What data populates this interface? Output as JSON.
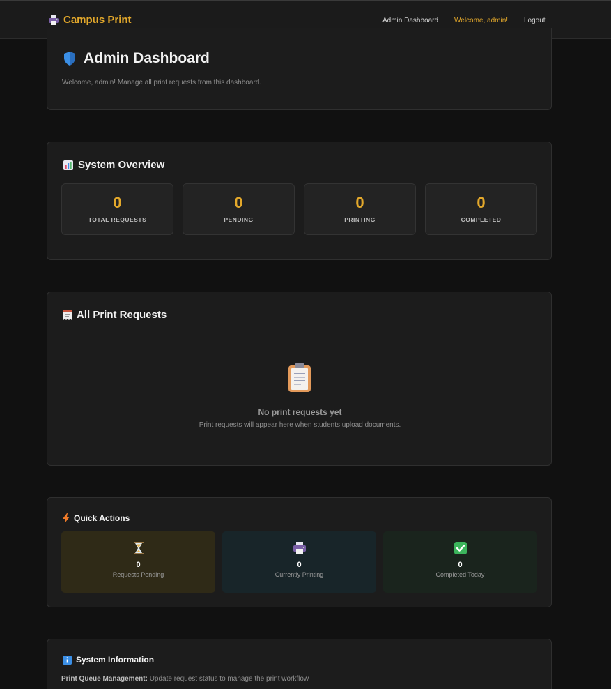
{
  "navbar": {
    "brand": "Campus Print",
    "brand_icon": "printer-icon",
    "links": {
      "dashboard": "Admin Dashboard",
      "welcome": "Welcome, admin!",
      "logout": "Logout"
    }
  },
  "header": {
    "icon": "shield-icon",
    "title": "Admin Dashboard",
    "subtitle": "Welcome, admin! Manage all print requests from this dashboard."
  },
  "overview": {
    "icon": "bar-chart-icon",
    "title": "System Overview",
    "stats": [
      {
        "value": "0",
        "label": "TOTAL REQUESTS"
      },
      {
        "value": "0",
        "label": "PENDING"
      },
      {
        "value": "0",
        "label": "PRINTING"
      },
      {
        "value": "0",
        "label": "COMPLETED"
      }
    ]
  },
  "requests": {
    "icon": "receipt-icon",
    "title": "All Print Requests",
    "empty_icon": "clipboard-icon",
    "empty_title": "No print requests yet",
    "empty_text": "Print requests will appear here when students upload documents."
  },
  "quick_actions": {
    "icon": "lightning-icon",
    "title": "Quick Actions",
    "items": [
      {
        "icon": "hourglass-icon",
        "value": "0",
        "label": "Requests Pending",
        "bg": "#2f2a17"
      },
      {
        "icon": "printer-icon",
        "value": "0",
        "label": "Currently Printing",
        "bg": "#182529"
      },
      {
        "icon": "check-mark-icon",
        "value": "0",
        "label": "Completed Today",
        "bg": "#1a241d"
      }
    ]
  },
  "system_info": {
    "icon": "info-icon",
    "title": "System Information",
    "line_label": "Print Queue Management:",
    "line_text": "Update request status to manage the print workflow"
  },
  "colors": {
    "accent": "#e3a82b",
    "background": "#111111",
    "card": "#1c1c1c"
  }
}
